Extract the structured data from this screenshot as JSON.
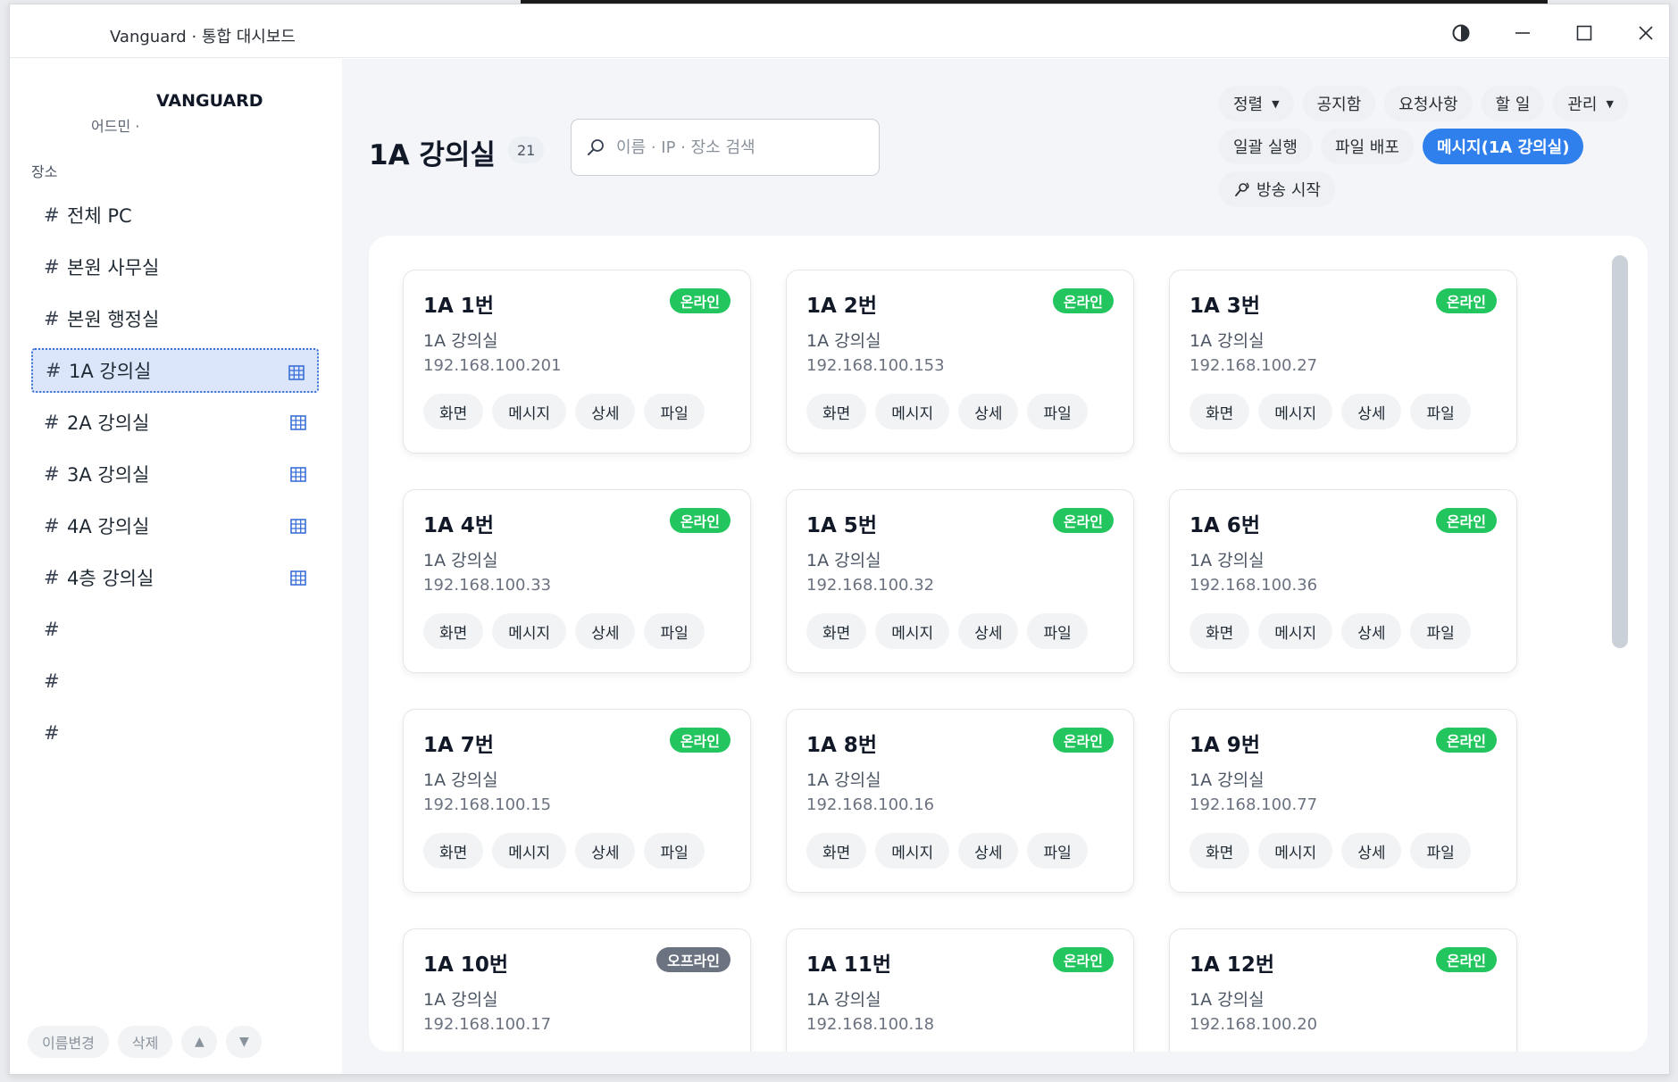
{
  "window": {
    "title": "Vanguard · 통합 대시보드"
  },
  "sidebar": {
    "brand": "VANGUARD",
    "role": "어드민 ·",
    "section_label": "장소",
    "items": [
      {
        "label": "전체 PC",
        "has_grid": false,
        "active": false
      },
      {
        "label": "본원 사무실",
        "has_grid": false,
        "active": false
      },
      {
        "label": "본원 행정실",
        "has_grid": false,
        "active": false
      },
      {
        "label": "1A 강의실",
        "has_grid": true,
        "active": true
      },
      {
        "label": "2A 강의실",
        "has_grid": true,
        "active": false
      },
      {
        "label": "3A 강의실",
        "has_grid": true,
        "active": false
      },
      {
        "label": "4A 강의실",
        "has_grid": true,
        "active": false
      },
      {
        "label": "4층 강의실",
        "has_grid": true,
        "active": false
      },
      {
        "label": "",
        "has_grid": false,
        "active": false
      },
      {
        "label": "",
        "has_grid": false,
        "active": false
      },
      {
        "label": "",
        "has_grid": false,
        "active": false
      }
    ],
    "hash": "#",
    "footer": {
      "rename": "이름변경",
      "delete": "삭제",
      "up": "▲",
      "down": "▼"
    }
  },
  "main": {
    "title": "1A 강의실",
    "count": "21",
    "search_placeholder": "이름 · IP · 장소 검색",
    "toolbar": {
      "sort": "정렬",
      "notice": "공지함",
      "requests": "요청사항",
      "todo": "할 일",
      "manage": "관리",
      "batch_run": "일괄 실행",
      "file_deploy": "파일 배포",
      "message": "메시지(1A 강의실)",
      "broadcast": "방송 시작"
    },
    "action_labels": {
      "screen": "화면",
      "message": "메시지",
      "detail": "상세",
      "file": "파일"
    },
    "cards": [
      {
        "name": "1A 1번",
        "status": "온라인",
        "online": true,
        "location": "1A 강의실",
        "ip": "192.168.100.201"
      },
      {
        "name": "1A 2번",
        "status": "온라인",
        "online": true,
        "location": "1A 강의실",
        "ip": "192.168.100.153"
      },
      {
        "name": "1A 3번",
        "status": "온라인",
        "online": true,
        "location": "1A 강의실",
        "ip": "192.168.100.27"
      },
      {
        "name": "1A 4번",
        "status": "온라인",
        "online": true,
        "location": "1A 강의실",
        "ip": "192.168.100.33"
      },
      {
        "name": "1A 5번",
        "status": "온라인",
        "online": true,
        "location": "1A 강의실",
        "ip": "192.168.100.32"
      },
      {
        "name": "1A 6번",
        "status": "온라인",
        "online": true,
        "location": "1A 강의실",
        "ip": "192.168.100.36"
      },
      {
        "name": "1A 7번",
        "status": "온라인",
        "online": true,
        "location": "1A 강의실",
        "ip": "192.168.100.15"
      },
      {
        "name": "1A 8번",
        "status": "온라인",
        "online": true,
        "location": "1A 강의실",
        "ip": "192.168.100.16"
      },
      {
        "name": "1A 9번",
        "status": "온라인",
        "online": true,
        "location": "1A 강의실",
        "ip": "192.168.100.77"
      },
      {
        "name": "1A 10번",
        "status": "오프라인",
        "online": false,
        "location": "1A 강의실",
        "ip": "192.168.100.17"
      },
      {
        "name": "1A 11번",
        "status": "온라인",
        "online": true,
        "location": "1A 강의실",
        "ip": "192.168.100.18"
      },
      {
        "name": "1A 12번",
        "status": "온라인",
        "online": true,
        "location": "1A 강의실",
        "ip": "192.168.100.20"
      }
    ]
  },
  "colors": {
    "online": "#22c55e",
    "offline": "#6b7280",
    "accent": "#2f80ed",
    "active_nav": "#dbe6fb"
  }
}
